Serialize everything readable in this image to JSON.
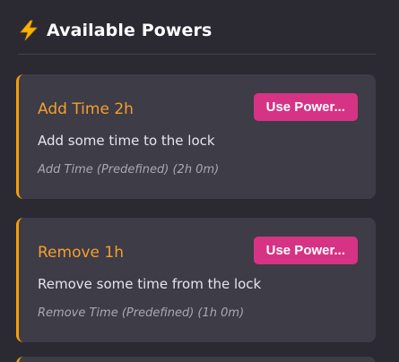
{
  "header": {
    "icon": "lightning-bolt-icon",
    "title": "Available Powers"
  },
  "colors": {
    "background": "#2b2a33",
    "card": "#3d3c47",
    "accent_border": "#f59e0b",
    "title": "#f59e2d",
    "button": "#d63384"
  },
  "powers": [
    {
      "title": "Add Time 2h",
      "description": "Add some time to the lock",
      "meta": "Add Time (Predefined) (2h 0m)",
      "button_label": "Use Power..."
    },
    {
      "title": "Remove 1h",
      "description": "Remove some time from the lock",
      "meta": "Remove Time (Predefined) (1h 0m)",
      "button_label": "Use Power..."
    }
  ]
}
